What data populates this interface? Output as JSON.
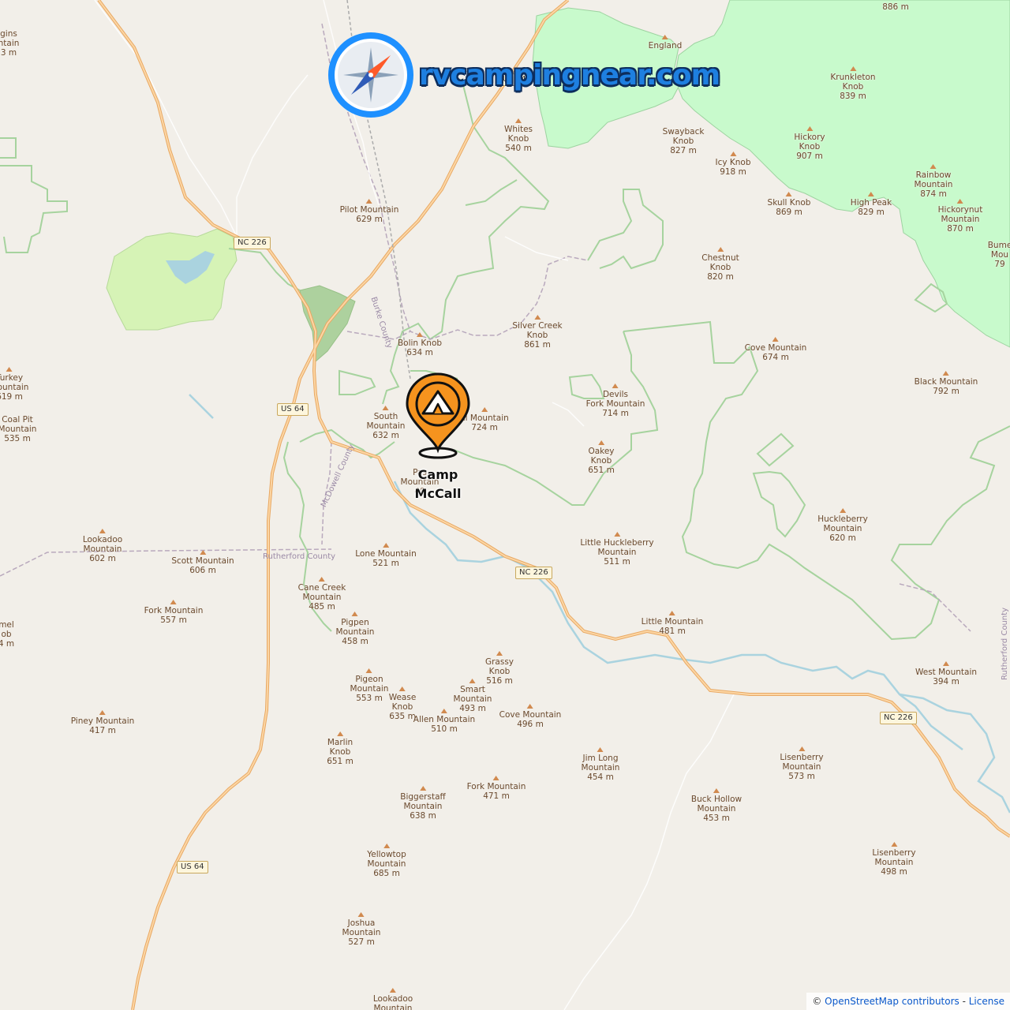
{
  "site": {
    "logo_text": "rvcampingnear.com"
  },
  "campsite": {
    "name": "Camp\nMcCall",
    "marker_icon": "tent-pin-icon"
  },
  "attribution": {
    "prefix": "©",
    "osm": "OpenStreetMap contributors",
    "separator": " - ",
    "license": "License"
  },
  "road_shields": [
    "NC 226",
    "US 64",
    "NC 226",
    "NC 226",
    "US 64",
    "US 64"
  ],
  "county_labels": [
    "Burke County",
    "McDowell County",
    "Rutherford County",
    "Rutherford County"
  ],
  "peaks": [
    [
      "Pilot Mountain",
      "629 m"
    ],
    [
      "Whites",
      "Knob",
      "540 m"
    ],
    [
      "Swayback",
      "Knob",
      "827 m"
    ],
    [
      "Icy Knob",
      "918 m"
    ],
    [
      "Krunkleton",
      "Knob",
      "839 m"
    ],
    [
      "Hickory",
      "Knob",
      "907 m"
    ],
    [
      "Skull Knob",
      "869 m"
    ],
    [
      "High Peak",
      "829 m"
    ],
    [
      "Rainbow",
      "Mountain",
      "874 m"
    ],
    [
      "Hickorynut",
      "Mountain",
      "870 m"
    ],
    [
      "Chestnut",
      "Knob",
      "820 m"
    ],
    [
      "Silver Creek",
      "Knob",
      "861 m"
    ],
    [
      "Bolin Knob",
      "634 m"
    ],
    [
      "Cove Mountain",
      "674 m"
    ],
    [
      "Black Mountain",
      "792 m"
    ],
    [
      "Devils",
      "Fork Mountain",
      "714 m"
    ],
    [
      "South",
      "Mountain",
      "632 m"
    ],
    [
      "al Mountain",
      "724 m"
    ],
    [
      "Oakey",
      "Knob",
      "651 m"
    ],
    [
      "Huckleberry",
      "Mountain",
      "620 m"
    ],
    [
      "Little Huckleberry",
      "Mountain",
      "511 m"
    ],
    [
      "Lookadoo",
      "Mountain",
      "602 m"
    ],
    [
      "Scott Mountain",
      "606 m"
    ],
    [
      "Lone Mountain",
      "521 m"
    ],
    [
      "Cane Creek",
      "Mountain",
      "485 m"
    ],
    [
      "Fork Mountain",
      "557 m"
    ],
    [
      "Pigpen",
      "Mountain",
      "458 m"
    ],
    [
      "Little Mountain",
      "481 m"
    ],
    [
      "West Mountain",
      "394 m"
    ],
    [
      "Grassy",
      "Knob",
      "516 m"
    ],
    [
      "Pigeon",
      "Mountain",
      "553 m"
    ],
    [
      "Wease",
      "Knob",
      "635 m"
    ],
    [
      "Smart",
      "Mountain",
      "493 m"
    ],
    [
      "Allen Mountain",
      "510 m"
    ],
    [
      "Cove Mountain",
      "496 m"
    ],
    [
      "Piney Mountain",
      "417 m"
    ],
    [
      "Marlin",
      "Knob",
      "651 m"
    ],
    [
      "Jim Long",
      "Mountain",
      "454 m"
    ],
    [
      "Lisenberry",
      "Mountain",
      "573 m"
    ],
    [
      "Fork Mountain",
      "471 m"
    ],
    [
      "Biggerstaff",
      "Mountain",
      "638 m"
    ],
    [
      "Buck Hollow",
      "Mountain",
      "453 m"
    ],
    [
      "Lisenberry",
      "Mountain",
      "498 m"
    ],
    [
      "Yellowtop",
      "Mountain",
      "685 m"
    ],
    [
      "Joshua",
      "Mountain",
      "527 m"
    ],
    [
      "Lookadoo",
      "Mountain"
    ],
    [
      "Turkey",
      "Mountain",
      "619 m"
    ],
    [
      "Coal Pit",
      "Mountain",
      "535 m"
    ],
    [
      "Pas",
      "Mountain",
      "49"
    ],
    [
      "England"
    ],
    [
      "gins",
      "ntain",
      "3 m"
    ],
    [
      "mel",
      "ob",
      "4 m"
    ],
    [
      "Bume",
      "Mou",
      "79"
    ],
    [
      "886 m"
    ]
  ]
}
